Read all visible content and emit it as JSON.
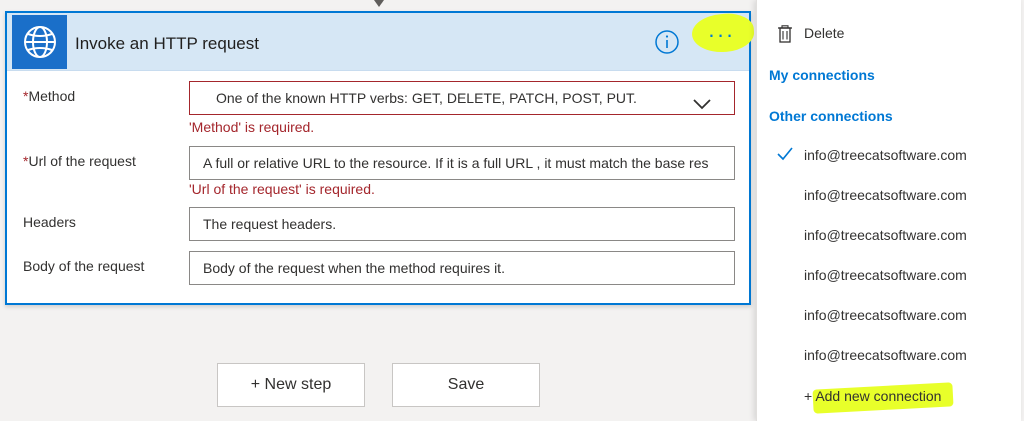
{
  "card": {
    "title": "Invoke an HTTP request",
    "icon": "globe-icon",
    "info_icon": "info-icon",
    "more_label": "..."
  },
  "fields": {
    "method": {
      "label": "Method",
      "required": "*",
      "placeholder": "One of the known HTTP verbs: GET, DELETE, PATCH, POST, PUT.",
      "error": "'Method' is required."
    },
    "url": {
      "label": "Url of the request",
      "required": "*",
      "placeholder": "A full or relative URL to the resource. If it is a full URL , it must match the base res",
      "error": "'Url of the request' is required."
    },
    "headers": {
      "label": "Headers",
      "placeholder": "The request headers."
    },
    "body": {
      "label": "Body of the request",
      "placeholder": "Body of the request when the method requires it."
    }
  },
  "buttons": {
    "new_step": "+ New step",
    "save": "Save"
  },
  "menu": {
    "delete_label": "Delete",
    "my_connections": "My connections",
    "other_connections": "Other connections",
    "connections": [
      "info@treecatsoftware.com",
      "info@treecatsoftware.com",
      "info@treecatsoftware.com",
      "info@treecatsoftware.com",
      "info@treecatsoftware.com",
      "info@treecatsoftware.com"
    ],
    "selected_index": 0,
    "add_prefix": "+",
    "add_label": "Add new connection"
  },
  "colors": {
    "accent": "#0078d4",
    "header_bg": "#d6e7f5",
    "error": "#a4262c",
    "highlight": "#e8ff2a"
  }
}
